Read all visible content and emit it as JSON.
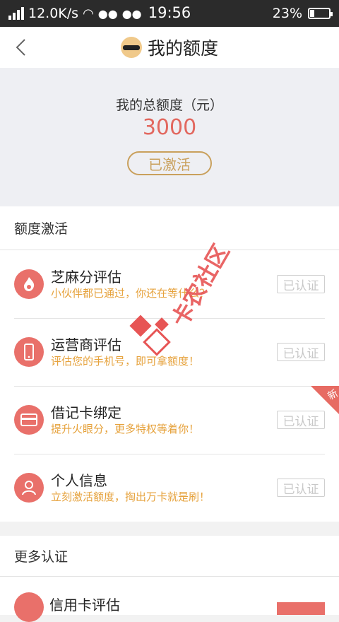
{
  "statusbar": {
    "speed": "12.0K/s",
    "time": "19:56",
    "battery": "23%",
    "battery_fraction": 0.23
  },
  "titlebar": {
    "title": "我的额度",
    "back_icon": "chevron-left-icon",
    "avatar_icon": "sunglasses-avatar-icon"
  },
  "summary": {
    "label": "我的总额度（元）",
    "amount": "3000",
    "status_button": "已激活"
  },
  "activation": {
    "header": "额度激活",
    "items": [
      {
        "title": "芝麻分评估",
        "subtitle": "小伙伴都已通过，你还在等什么？",
        "status": "已认证",
        "icon": "flame-icon"
      },
      {
        "title": "运营商评估",
        "subtitle": "评估您的手机号，即可拿额度！",
        "status": "已认证",
        "icon": "phone-icon"
      },
      {
        "title": "借记卡绑定",
        "subtitle": "提升火眼分，更多特权等着你！",
        "status": "已认证",
        "icon": "card-icon",
        "tag": "新"
      },
      {
        "title": "个人信息",
        "subtitle": "立刻激活额度，掏出万卡就是刷！",
        "status": "已认证",
        "icon": "person-icon"
      }
    ]
  },
  "more": {
    "header": "更多认证",
    "items": [
      {
        "title": "信用卡评估",
        "icon": "credit-card-icon"
      }
    ]
  },
  "watermark": {
    "text": "卡农社区"
  },
  "colors": {
    "accent_red": "#e9706a",
    "accent_gold": "#c9a05c",
    "subtitle_orange": "#e6a23c"
  }
}
